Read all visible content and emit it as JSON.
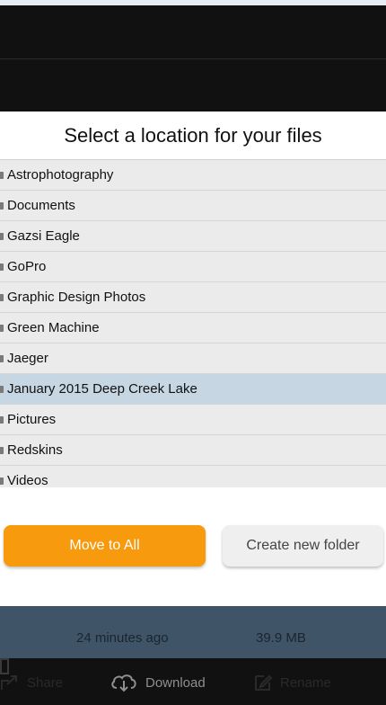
{
  "dialog": {
    "title": "Select a location for your files",
    "folders": [
      {
        "label": "Astrophotography",
        "selected": false
      },
      {
        "label": "Documents",
        "selected": false
      },
      {
        "label": "Gazsi Eagle",
        "selected": false
      },
      {
        "label": "GoPro",
        "selected": false
      },
      {
        "label": "Graphic Design Photos",
        "selected": false
      },
      {
        "label": "Green Machine",
        "selected": false
      },
      {
        "label": "Jaeger",
        "selected": false
      },
      {
        "label": "January 2015 Deep Creek Lake",
        "selected": true
      },
      {
        "label": "Pictures",
        "selected": false
      },
      {
        "label": "Redskins",
        "selected": false
      },
      {
        "label": "Videos",
        "selected": false
      }
    ],
    "move_button": "Move to All",
    "create_button": "Create new folder"
  },
  "file_info": {
    "modified": "24 minutes ago",
    "size": "39.9 MB"
  },
  "toolbar": {
    "share": "Share",
    "download": "Download",
    "rename": "Rename"
  },
  "colors": {
    "accent": "#f89a0e",
    "selected_row": "#c7d6e3",
    "info_bar": "#3f5567"
  }
}
